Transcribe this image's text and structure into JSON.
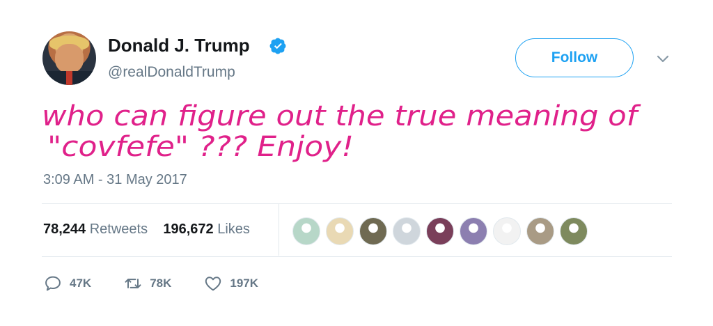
{
  "user": {
    "name": "Donald J. Trump",
    "handle": "@realDonaldTrump",
    "verified_color": "#1da1f2"
  },
  "header": {
    "follow_label": "Follow"
  },
  "tweet": {
    "handwritten_lines": [
      "who can figure out the true meaning of",
      "\"covfefe\" ??? Enjoy!"
    ],
    "text_color": "#e0218a",
    "timestamp": "3:09 AM - 31 May 2017"
  },
  "stats": {
    "retweets_count": "78,244",
    "retweets_label": "Retweets",
    "likes_count": "196,672",
    "likes_label": "Likes"
  },
  "actions": {
    "reply_count": "47K",
    "retweet_count": "78K",
    "like_count": "197K"
  },
  "likers": [
    {
      "name": "liker-avatar",
      "color": "#b7d7c8"
    },
    {
      "name": "liker-avatar",
      "color": "#e9d9b4"
    },
    {
      "name": "liker-avatar",
      "color": "#6f6a52"
    },
    {
      "name": "liker-avatar",
      "color": "#cfd6dc"
    },
    {
      "name": "liker-avatar",
      "color": "#7a3f5a"
    },
    {
      "name": "liker-avatar",
      "color": "#8c7fb0"
    },
    {
      "name": "liker-avatar",
      "color": "#f2f2f2"
    },
    {
      "name": "liker-avatar",
      "color": "#a99b85"
    },
    {
      "name": "liker-avatar",
      "color": "#7e8a5e"
    }
  ]
}
